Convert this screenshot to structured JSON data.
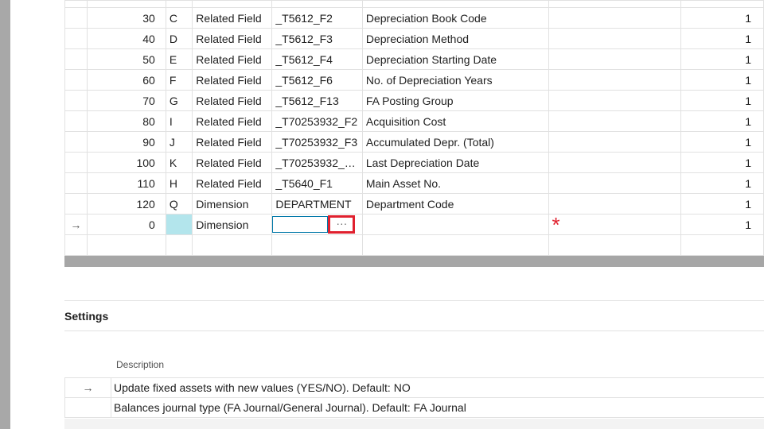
{
  "mapping_grid": {
    "rows": [
      {
        "no": "30",
        "col": "C",
        "type": "Related Field",
        "field": "_T5612_F2",
        "desc": "Depreciation Book Code",
        "qty": "1"
      },
      {
        "no": "40",
        "col": "D",
        "type": "Related Field",
        "field": "_T5612_F3",
        "desc": "Depreciation Method",
        "qty": "1"
      },
      {
        "no": "50",
        "col": "E",
        "type": "Related Field",
        "field": "_T5612_F4",
        "desc": "Depreciation Starting Date",
        "qty": "1"
      },
      {
        "no": "60",
        "col": "F",
        "type": "Related Field",
        "field": "_T5612_F6",
        "desc": "No. of Depreciation Years",
        "qty": "1"
      },
      {
        "no": "70",
        "col": "G",
        "type": "Related Field",
        "field": "_T5612_F13",
        "desc": "FA Posting Group",
        "qty": "1"
      },
      {
        "no": "80",
        "col": "I",
        "type": "Related Field",
        "field": "_T70253932_F2",
        "desc": "Acquisition Cost",
        "qty": "1"
      },
      {
        "no": "90",
        "col": "J",
        "type": "Related Field",
        "field": "_T70253932_F3",
        "desc": "Accumulated Depr. (Total)",
        "qty": "1"
      },
      {
        "no": "100",
        "col": "K",
        "type": "Related Field",
        "field": "_T70253932_F...",
        "desc": "Last Depreciation Date",
        "qty": "1"
      },
      {
        "no": "110",
        "col": "H",
        "type": "Related Field",
        "field": "_T5640_F1",
        "desc": "Main Asset No.",
        "qty": "1"
      },
      {
        "no": "120",
        "col": "Q",
        "type": "Dimension",
        "field": "DEPARTMENT",
        "desc": "Department Code",
        "qty": "1"
      }
    ],
    "current_row": {
      "arrow": "→",
      "no": "0",
      "type": "Dimension",
      "lookup_label": "···",
      "required_mark": "*",
      "qty": "1"
    }
  },
  "settings": {
    "title": "Settings",
    "column_header": "Description",
    "rows": [
      {
        "arrow": "→",
        "desc": "Update fixed assets with new values (YES/NO).  Default: NO"
      },
      {
        "arrow": "",
        "desc": "Balances journal type (FA Journal/General Journal). Default: FA Journal"
      }
    ]
  },
  "colors": {
    "accent": "#0078a8",
    "highlight_box": "#e0202e",
    "selected_cell": "#b3e5ec"
  }
}
